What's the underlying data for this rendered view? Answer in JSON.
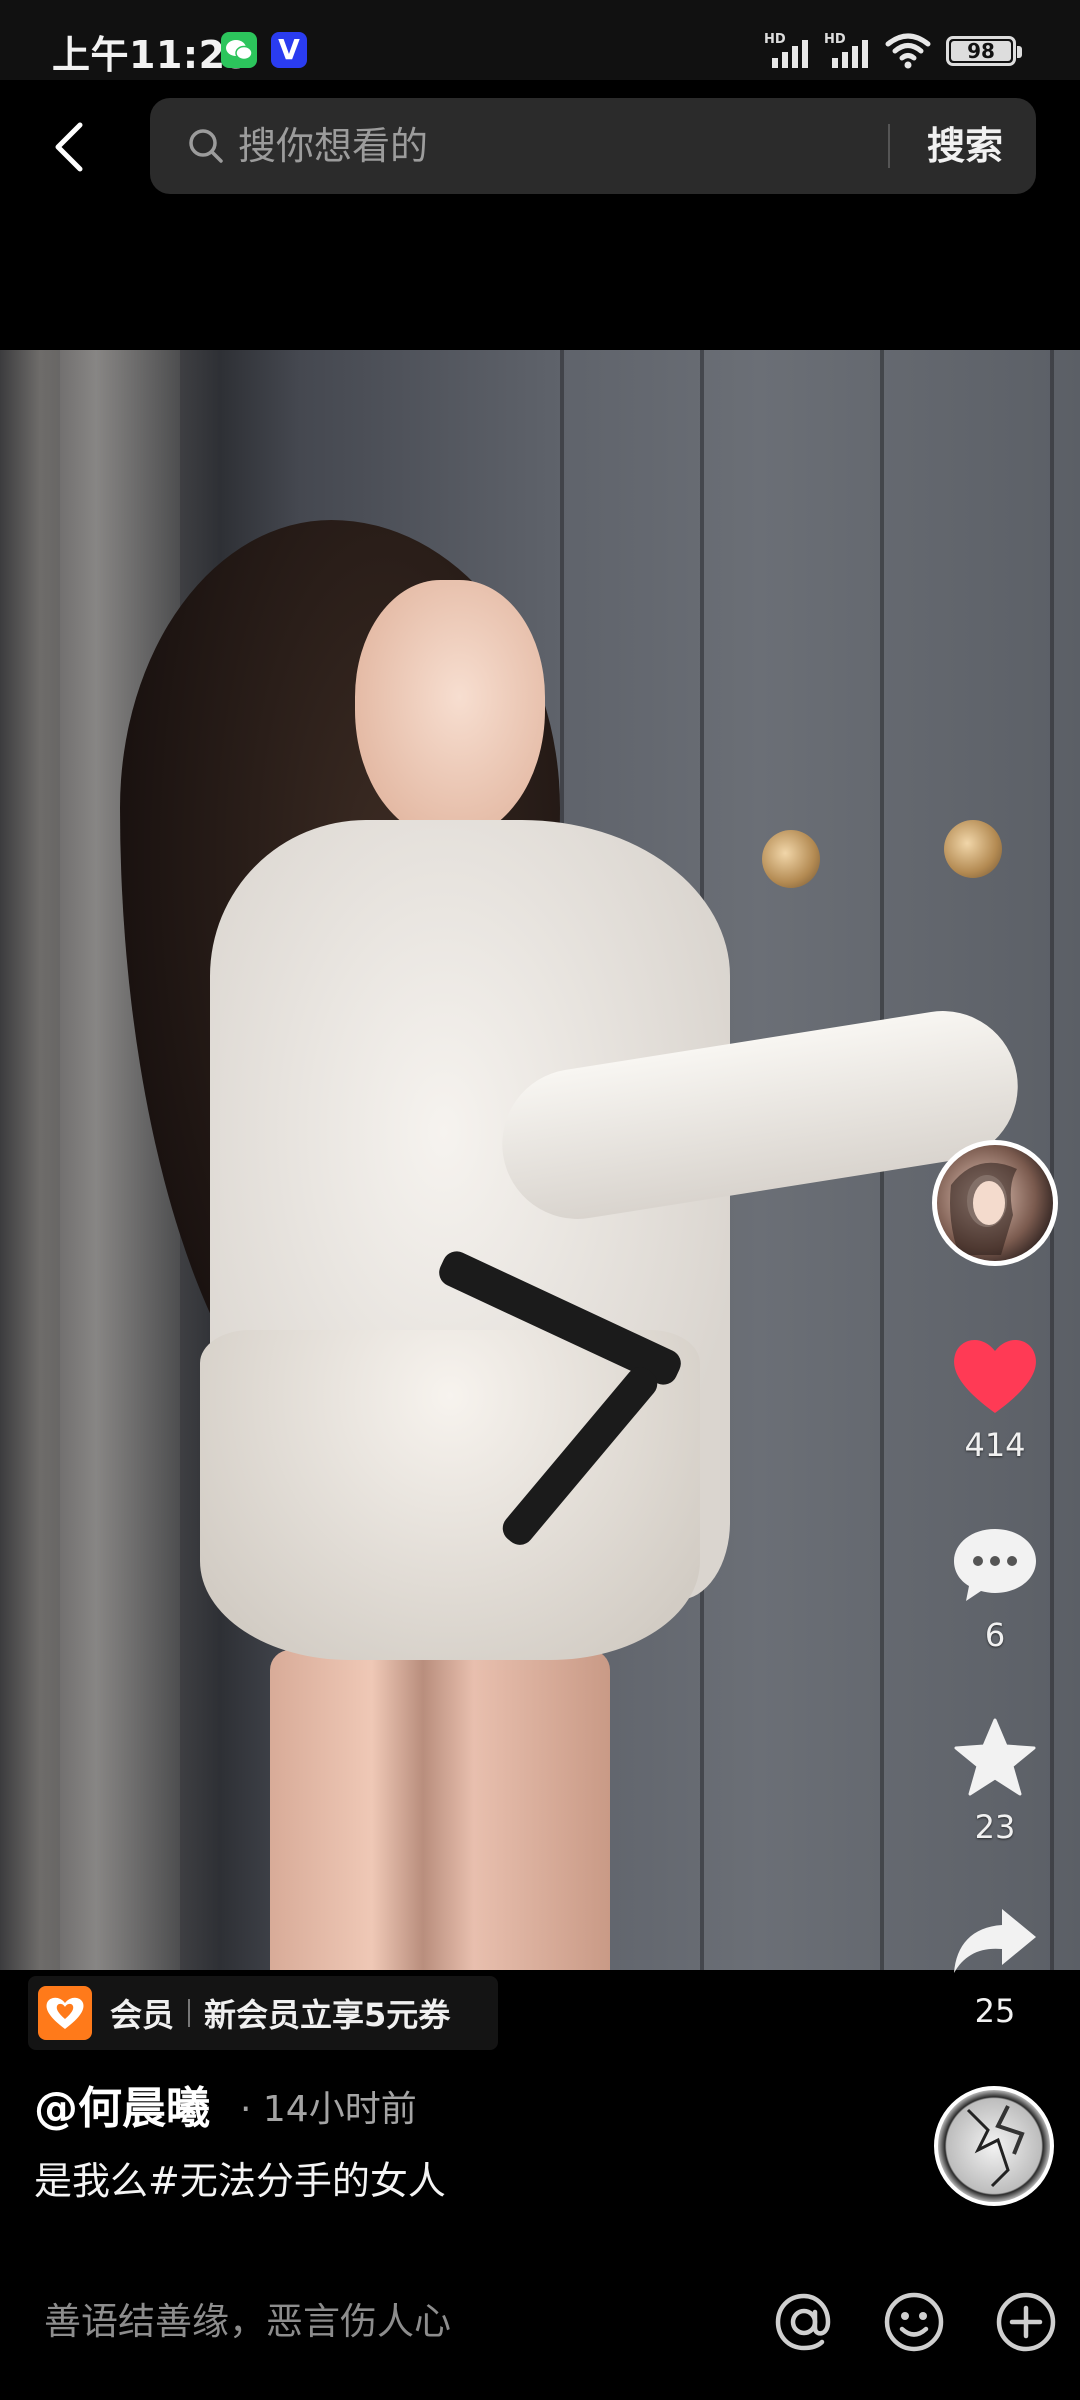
{
  "status_bar": {
    "time": "上午11:29",
    "network_label": "HD",
    "battery": "98",
    "wechat_badge_color": "#2cc55c",
    "v_badge_text": "V",
    "v_badge_color": "#2a3cf0"
  },
  "search": {
    "placeholder": "搜你想看的",
    "button_label": "搜索",
    "icon": "search-icon"
  },
  "actions": {
    "like_count": "414",
    "comment_count": "6",
    "favorite_count": "23",
    "share_count": "25",
    "like_color": "#ff3a55"
  },
  "vip": {
    "label": "会员",
    "promo": "新会员立享5元券",
    "accent": "#ff7a1a"
  },
  "post": {
    "author": "@何晨曦",
    "time": "· 14小时前",
    "caption": "是我么#无法分手的女人"
  },
  "comment_bar": {
    "placeholder": "善语结善缘，恶言伤人心",
    "icons": [
      "at-icon",
      "emoji-icon",
      "plus-icon"
    ]
  }
}
